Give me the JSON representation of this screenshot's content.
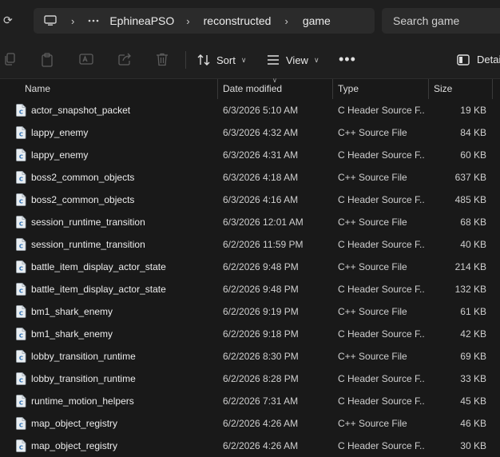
{
  "breadcrumb": {
    "items": [
      {
        "label": "EphineaPSO"
      },
      {
        "label": "reconstructed"
      },
      {
        "label": "game"
      }
    ]
  },
  "search": {
    "placeholder": "Search game"
  },
  "toolbar": {
    "sort_label": "Sort",
    "view_label": "View",
    "more_label": "•••",
    "details_label": "Details"
  },
  "columns": {
    "name": "Name",
    "date": "Date modified",
    "type": "Type",
    "size": "Size"
  },
  "files": [
    {
      "name": "actor_snapshot_packet",
      "date": "6/3/2026 5:10 AM",
      "type": "C Header Source F...",
      "size": "19 KB"
    },
    {
      "name": "lappy_enemy",
      "date": "6/3/2026 4:32 AM",
      "type": "C++ Source File",
      "size": "84 KB"
    },
    {
      "name": "lappy_enemy",
      "date": "6/3/2026 4:31 AM",
      "type": "C Header Source F...",
      "size": "60 KB"
    },
    {
      "name": "boss2_common_objects",
      "date": "6/3/2026 4:18 AM",
      "type": "C++ Source File",
      "size": "637 KB"
    },
    {
      "name": "boss2_common_objects",
      "date": "6/3/2026 4:16 AM",
      "type": "C Header Source F...",
      "size": "485 KB"
    },
    {
      "name": "session_runtime_transition",
      "date": "6/3/2026 12:01 AM",
      "type": "C++ Source File",
      "size": "68 KB"
    },
    {
      "name": "session_runtime_transition",
      "date": "6/2/2026 11:59 PM",
      "type": "C Header Source F...",
      "size": "40 KB"
    },
    {
      "name": "battle_item_display_actor_state",
      "date": "6/2/2026 9:48 PM",
      "type": "C++ Source File",
      "size": "214 KB"
    },
    {
      "name": "battle_item_display_actor_state",
      "date": "6/2/2026 9:48 PM",
      "type": "C Header Source F...",
      "size": "132 KB"
    },
    {
      "name": "bm1_shark_enemy",
      "date": "6/2/2026 9:19 PM",
      "type": "C++ Source File",
      "size": "61 KB"
    },
    {
      "name": "bm1_shark_enemy",
      "date": "6/2/2026 9:18 PM",
      "type": "C Header Source F...",
      "size": "42 KB"
    },
    {
      "name": "lobby_transition_runtime",
      "date": "6/2/2026 8:30 PM",
      "type": "C++ Source File",
      "size": "69 KB"
    },
    {
      "name": "lobby_transition_runtime",
      "date": "6/2/2026 8:28 PM",
      "type": "C Header Source F...",
      "size": "33 KB"
    },
    {
      "name": "runtime_motion_helpers",
      "date": "6/2/2026 7:31 AM",
      "type": "C Header Source F...",
      "size": "45 KB"
    },
    {
      "name": "map_object_registry",
      "date": "6/2/2026 4:26 AM",
      "type": "C++ Source File",
      "size": "46 KB"
    },
    {
      "name": "map_object_registry",
      "date": "6/2/2026 4:26 AM",
      "type": "C Header Source F...",
      "size": "30 KB"
    }
  ],
  "icons": {
    "refresh": "refresh-icon",
    "computer": "computer-icon",
    "more": "more-icon",
    "file": "code-file-icon",
    "sort": "sort-icon",
    "view": "view-icon",
    "details": "details-pane-icon"
  },
  "colors": {
    "background": "#191919",
    "bar": "#1f1f1f",
    "field": "#2b2b2b",
    "text": "#e6e6e6",
    "muted": "#cfcfcf",
    "disabled": "#5d5d5d",
    "accent": "#4aa3f0"
  }
}
